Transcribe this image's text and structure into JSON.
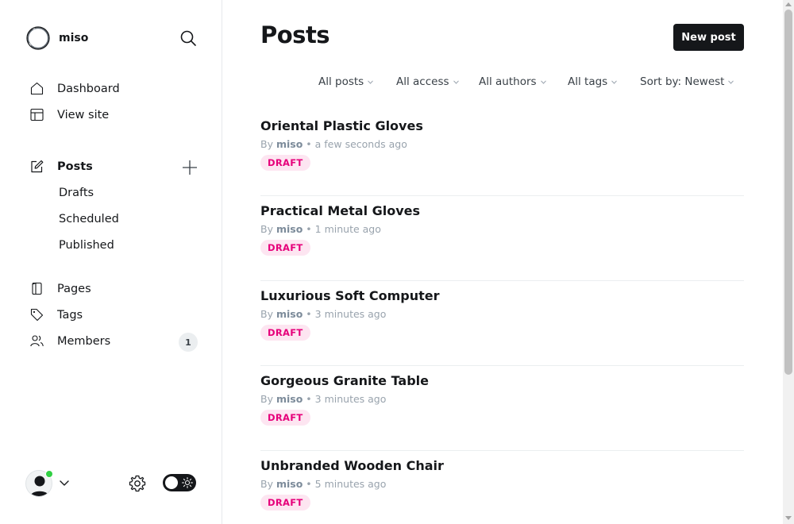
{
  "brand": {
    "name": "miso",
    "logo_icon": "brand-ring-icon"
  },
  "sidebar": {
    "search_icon": "search-icon",
    "nav": [
      {
        "label": "Dashboard",
        "icon": "home-icon"
      },
      {
        "label": "View site",
        "icon": "layout-icon"
      }
    ],
    "posts": {
      "label": "Posts",
      "icon": "edit-icon",
      "add_icon": "plus-icon",
      "sub": [
        "Drafts",
        "Scheduled",
        "Published"
      ]
    },
    "more": [
      {
        "label": "Pages",
        "icon": "page-icon"
      },
      {
        "label": "Tags",
        "icon": "tag-icon"
      },
      {
        "label": "Members",
        "icon": "members-icon",
        "badge": "1"
      }
    ],
    "footer": {
      "online_status_color": "#30cf43",
      "settings_icon": "gear-icon",
      "theme": "dark-mode-toggle"
    }
  },
  "main": {
    "title": "Posts",
    "new_post_label": "New post",
    "filters": [
      "All posts",
      "All access",
      "All authors",
      "All tags",
      "Sort by: Newest"
    ]
  },
  "posts": [
    {
      "title": "Oriental Plastic Gloves",
      "by": "By",
      "author": "miso",
      "time": "• a few seconds ago",
      "status": "DRAFT"
    },
    {
      "title": "Practical Metal Gloves",
      "by": "By",
      "author": "miso",
      "time": "• 1 minute ago",
      "status": "DRAFT"
    },
    {
      "title": "Luxurious Soft Computer",
      "by": "By",
      "author": "miso",
      "time": "• 3 minutes ago",
      "status": "DRAFT"
    },
    {
      "title": "Gorgeous Granite Table",
      "by": "By",
      "author": "miso",
      "time": "• 3 minutes ago",
      "status": "DRAFT"
    },
    {
      "title": "Unbranded Wooden Chair",
      "by": "By",
      "author": "miso",
      "time": "• 5 minutes ago",
      "status": "DRAFT"
    }
  ],
  "colors": {
    "accent": "#15171a",
    "draft_text": "#e6007a",
    "draft_bg": "#fde5f1",
    "muted": "#99a3ad"
  }
}
